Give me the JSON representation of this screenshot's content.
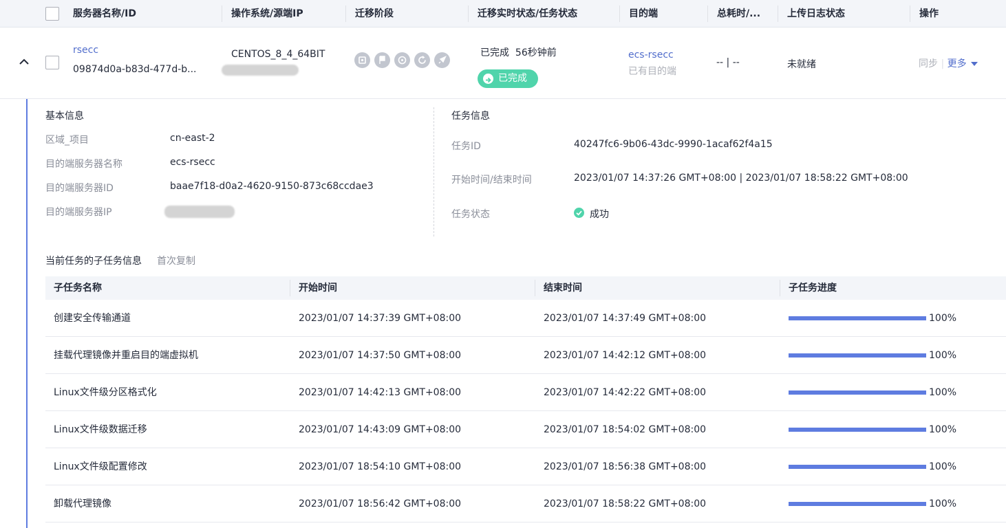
{
  "table": {
    "headers": [
      "服务器名称/ID",
      "操作系统/源端IP",
      "迁移阶段",
      "迁移实时状态/任务状态",
      "目的端",
      "总耗时/...",
      "上传日志状态",
      "操作"
    ]
  },
  "server": {
    "name": "rsecc",
    "id": "09874d0a-b83d-477d-b...",
    "os": "CENTOS_8_4_64BIT",
    "status_text": "已完成",
    "status_time": "56秒钟前",
    "task_status": "已完成",
    "target_name": "ecs-rsecc",
    "target_note": "已有目的端",
    "duration": "-- | --",
    "log_status": "未就绪",
    "action_sync": "同步",
    "action_sep": "|",
    "action_more": "更多",
    "stage_icons": [
      "image-icon",
      "flag-icon",
      "sync-icon",
      "refresh-icon",
      "rocket-icon"
    ]
  },
  "basic_info": {
    "title": "基本信息",
    "rows": [
      {
        "label": "区域_项目",
        "value": "cn-east-2"
      },
      {
        "label": "目的端服务器名称",
        "value": "ecs-rsecc"
      },
      {
        "label": "目的端服务器ID",
        "value": "baae7f18-d0a2-4620-9150-873c68ccdae3"
      },
      {
        "label": "目的端服务器IP",
        "value": ""
      }
    ]
  },
  "task_info": {
    "title": "任务信息",
    "rows": [
      {
        "label": "任务ID",
        "value": "40247fc6-9b06-43dc-9990-1acaf62f4a15"
      },
      {
        "label": "开始时间/结束时间",
        "value": "2023/01/07 14:37:26 GMT+08:00 | 2023/01/07 18:58:22 GMT+08:00"
      },
      {
        "label": "任务状态",
        "value": "成功"
      }
    ]
  },
  "subtasks": {
    "title": "当前任务的子任务信息",
    "subtitle": "首次复制",
    "headers": [
      "子任务名称",
      "开始时间",
      "结束时间",
      "子任务进度"
    ],
    "rows": [
      {
        "name": "创建安全传输通道",
        "start": "2023/01/07 14:37:39 GMT+08:00",
        "end": "2023/01/07 14:37:49 GMT+08:00",
        "progress": 100,
        "progress_label": "100%"
      },
      {
        "name": "挂载代理镜像并重启目的端虚拟机",
        "start": "2023/01/07 14:37:50 GMT+08:00",
        "end": "2023/01/07 14:42:12 GMT+08:00",
        "progress": 100,
        "progress_label": "100%"
      },
      {
        "name": "Linux文件级分区格式化",
        "start": "2023/01/07 14:42:13 GMT+08:00",
        "end": "2023/01/07 14:42:22 GMT+08:00",
        "progress": 100,
        "progress_label": "100%"
      },
      {
        "name": "Linux文件级数据迁移",
        "start": "2023/01/07 14:43:09 GMT+08:00",
        "end": "2023/01/07 18:54:02 GMT+08:00",
        "progress": 100,
        "progress_label": "100%"
      },
      {
        "name": "Linux文件级配置修改",
        "start": "2023/01/07 18:54:10 GMT+08:00",
        "end": "2023/01/07 18:56:38 GMT+08:00",
        "progress": 100,
        "progress_label": "100%"
      },
      {
        "name": "卸载代理镜像",
        "start": "2023/01/07 18:56:42 GMT+08:00",
        "end": "2023/01/07 18:58:22 GMT+08:00",
        "progress": 100,
        "progress_label": "100%"
      }
    ]
  },
  "colors": {
    "accent": "#5e7ce0",
    "link": "#526ecc",
    "success": "#50d4ab",
    "header_bg": "#f3f5f9"
  }
}
